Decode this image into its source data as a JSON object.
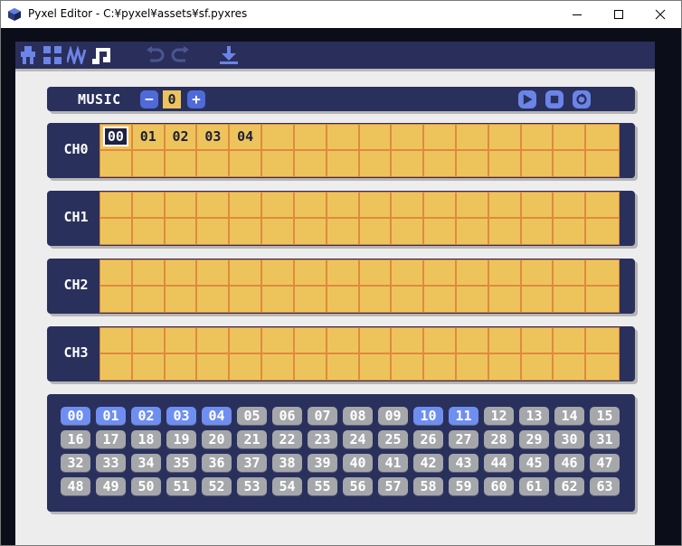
{
  "window": {
    "title": "Pyxel Editor - C:¥pyxel¥assets¥sf.pyxres",
    "controls": [
      "minimize",
      "maximize",
      "close"
    ]
  },
  "toolbar": {
    "tools": [
      "image-editor",
      "tilemap-editor",
      "sound-editor",
      "music-editor"
    ],
    "active_tool": "music-editor",
    "actions": [
      "undo",
      "redo",
      "export"
    ]
  },
  "music": {
    "label": "MUSIC",
    "minus": "−",
    "number": "0",
    "plus": "+",
    "playback": [
      "play",
      "stop",
      "loop"
    ]
  },
  "channels": [
    {
      "label": "CH0",
      "sounds": [
        "00",
        "01",
        "02",
        "03",
        "04"
      ],
      "selected": 0
    },
    {
      "label": "CH1",
      "sounds": []
    },
    {
      "label": "CH2",
      "sounds": []
    },
    {
      "label": "CH3",
      "sounds": []
    }
  ],
  "sound_palette": {
    "items": [
      "00",
      "01",
      "02",
      "03",
      "04",
      "05",
      "06",
      "07",
      "08",
      "09",
      "10",
      "11",
      "12",
      "13",
      "14",
      "15",
      "16",
      "17",
      "18",
      "19",
      "20",
      "21",
      "22",
      "23",
      "24",
      "25",
      "26",
      "27",
      "28",
      "29",
      "30",
      "31",
      "32",
      "33",
      "34",
      "35",
      "36",
      "37",
      "38",
      "39",
      "40",
      "41",
      "42",
      "43",
      "44",
      "45",
      "46",
      "47",
      "48",
      "49",
      "50",
      "51",
      "52",
      "53",
      "54",
      "55",
      "56",
      "57",
      "58",
      "59",
      "60",
      "61",
      "62",
      "63"
    ],
    "used": [
      "00",
      "01",
      "02",
      "03",
      "04",
      "10",
      "11"
    ]
  },
  "colors": {
    "panel": "#29305c",
    "grid_fill": "#edc45c",
    "grid_line": "#e08a3e",
    "accent_blue": "#6f8ff0",
    "inactive_gray": "#a5a7aa"
  }
}
